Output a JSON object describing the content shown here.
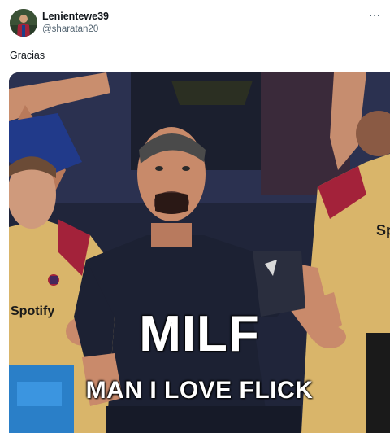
{
  "post": {
    "display_name": "Lenientewe39",
    "handle": "@sharatan20",
    "more_label": "···",
    "text": "Gracias"
  },
  "media": {
    "caption_main": "MILF",
    "caption_sub": "MAN I LOVE FLICK",
    "sponsor_text": "Spotify"
  },
  "colors": {
    "name": "#0f1419",
    "handle": "#536471",
    "kit_gold": "#d9b56a",
    "kit_blue": "#1b2a6b",
    "coach_top": "#1c2133",
    "caption": "#ffffff"
  },
  "icons": {
    "more": "more-horizontal-icon",
    "avatar": "user-avatar"
  }
}
